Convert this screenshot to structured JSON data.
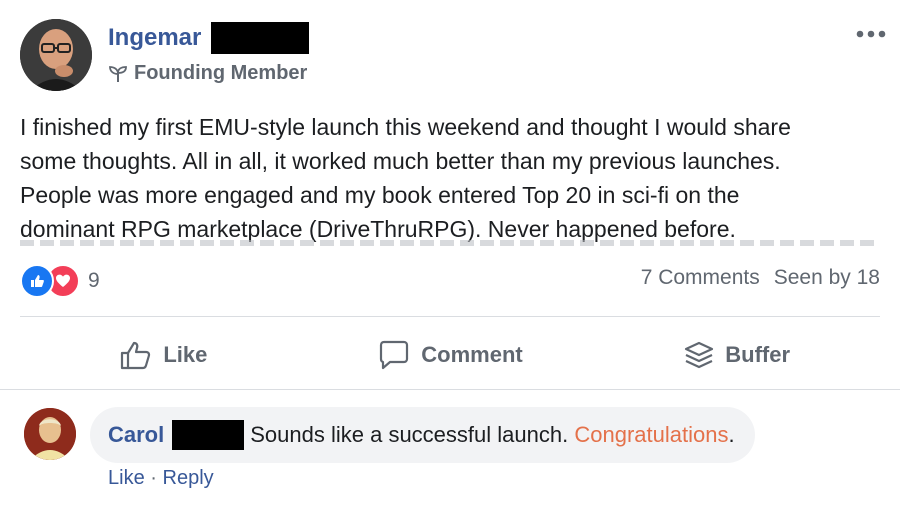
{
  "post": {
    "author_name": "Ingemar",
    "badge": "Founding Member",
    "body_lines": [
      "I finished my first EMU-style launch this weekend and thought I would share",
      "some thoughts. All in all, it worked much better than my previous launches.",
      "People was more engaged and my book entered Top 20 in sci-fi on the",
      "dominant RPG marketplace (DriveThruRPG). Never happened before."
    ],
    "reaction_count": "9",
    "comments_count": "7 Comments",
    "seen_by": "Seen by 18"
  },
  "actions": {
    "like": "Like",
    "comment": "Comment",
    "buffer": "Buffer"
  },
  "comment": {
    "author_name": "Carol",
    "text": "Sounds like a successful launch.",
    "highlight": "Congratulations",
    "trailing": ".",
    "like_link": "Like",
    "separator": "·",
    "reply_link": "Reply"
  },
  "icons": {
    "more": "more-horizontal-icon",
    "badge": "sprout-icon",
    "like": "thumbs-up-icon",
    "comment": "speech-bubble-icon",
    "buffer": "layers-stack-icon"
  },
  "colors": {
    "link_blue": "#385898",
    "like_blue": "#1877f2",
    "love_red": "#f33e58",
    "muted": "#606770",
    "highlight": "#e4714a"
  }
}
